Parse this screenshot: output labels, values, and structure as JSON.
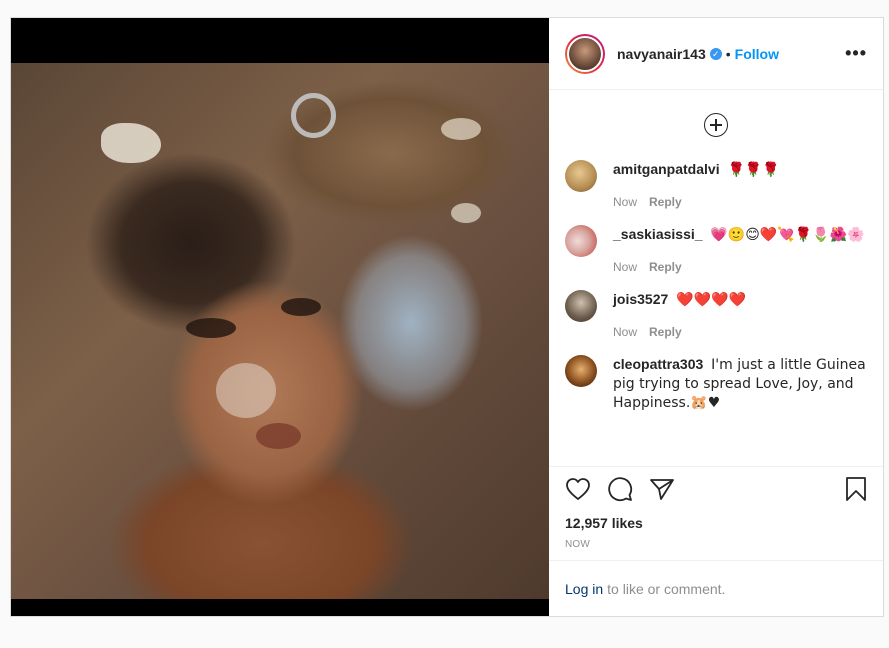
{
  "post": {
    "username": "navyanair143",
    "verified_icon": "verified-badge-icon",
    "separator": "•",
    "follow_label": "Follow",
    "more_label": "•••",
    "photo_alt": "baby-photo"
  },
  "comments": [
    {
      "user": "amitganpatdalvi",
      "text": "🌹🌹🌹",
      "time": "Now",
      "reply": "Reply"
    },
    {
      "user": "_saskiasissi_",
      "text": "💗🙂😊❤️💘🌹🌷🌺🌸",
      "time": "Now",
      "reply": "Reply"
    },
    {
      "user": "jois3527",
      "text": "❤️❤️❤️❤️",
      "time": "Now",
      "reply": "Reply"
    },
    {
      "user": "cleopattra303",
      "text": "I'm just a little Guinea pig trying to spread  Love, Joy, and Happiness.🐹♥",
      "time": "",
      "reply": ""
    }
  ],
  "actions": {
    "likes": "12,957 likes",
    "time": "NOW",
    "icons": [
      "heart-icon",
      "comment-icon",
      "share-icon",
      "bookmark-icon"
    ]
  },
  "footer": {
    "login_link": "Log in",
    "login_rest": "to like or comment."
  },
  "colors": {
    "accent": "#0095f6",
    "link": "#00376b",
    "muted": "#8e8e8e"
  }
}
